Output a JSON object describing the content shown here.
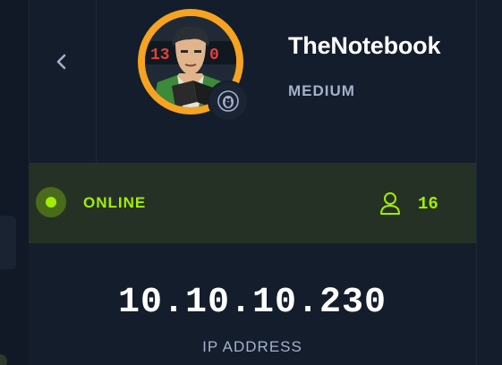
{
  "machine": {
    "name": "TheNotebook",
    "difficulty": "MEDIUM",
    "os_icon": "linux-penguin-icon",
    "avatar": "machine-avatar"
  },
  "status": {
    "label": "ONLINE",
    "user_count": "16"
  },
  "network": {
    "ip": "10.10.10.230",
    "ip_label": "IP ADDRESS"
  },
  "colors": {
    "background": "#141d2b",
    "accent_green": "#9fef00",
    "status_bar_bg": "#263126",
    "avatar_ring": "#f5a320",
    "muted_text": "#a4b1cd"
  }
}
